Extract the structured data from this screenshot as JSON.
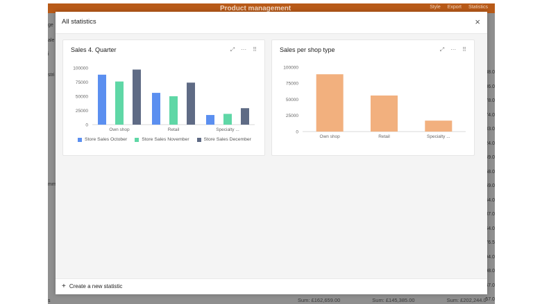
{
  "background": {
    "title": "Product management",
    "toolbar": [
      "Style",
      "Export",
      "Statistics"
    ],
    "left_fragments": [
      "ge",
      "ale",
      "i",
      "stri",
      "mm",
      "s"
    ],
    "right_fragments": [
      "38.0",
      "36.0",
      "78.0",
      "74.0",
      "83.0",
      "24.0",
      "59.0",
      "58.0",
      "69.0",
      "54.0",
      "87.0",
      "64.0",
      "76.5",
      "94.0",
      "98.0",
      "57.0",
      "57.0"
    ],
    "sums": [
      "Sum: £162,659.00",
      "Sum: £145,385.00",
      "Sum: £202,244.0"
    ]
  },
  "modal": {
    "title": "All statistics",
    "close_icon": "×",
    "create_label": "Create a new statistic",
    "create_plus": "+"
  },
  "cards": [
    {
      "title": "Sales 4. Quarter",
      "icons": [
        "⤢",
        "···",
        "⠿"
      ]
    },
    {
      "title": "Sales per shop type",
      "icons": [
        "⤢",
        "···",
        "⠿"
      ]
    }
  ],
  "chart_data": [
    {
      "type": "bar",
      "title": "Sales 4. Quarter",
      "categories": [
        "Own shop",
        "Retail",
        "Specialty ..."
      ],
      "ylim": [
        0,
        100000
      ],
      "yticks": [
        0,
        25000,
        50000,
        75000,
        100000
      ],
      "ytick_labels": [
        "0",
        "25000",
        "50000",
        "75000",
        "100000"
      ],
      "series": [
        {
          "name": "Store Sales October",
          "color": "#5b8ff0",
          "values": [
            88000,
            56000,
            17000
          ]
        },
        {
          "name": "Store Sales November",
          "color": "#5fd7a6",
          "values": [
            76000,
            50000,
            19000
          ]
        },
        {
          "name": "Store Sales December",
          "color": "#5f6b85",
          "values": [
            97000,
            74000,
            29000
          ]
        }
      ],
      "legend": "bottom"
    },
    {
      "type": "bar",
      "title": "Sales per shop type",
      "categories": [
        "Own shop",
        "Retail",
        "Specialty ..."
      ],
      "ylim": [
        0,
        100000
      ],
      "yticks": [
        0,
        25000,
        50000,
        75000,
        100000
      ],
      "ytick_labels": [
        "0",
        "25000",
        "50000",
        "75000",
        "100000"
      ],
      "series": [
        {
          "color": "#f2b07e",
          "values": [
            89000,
            56000,
            17000
          ]
        }
      ]
    }
  ]
}
